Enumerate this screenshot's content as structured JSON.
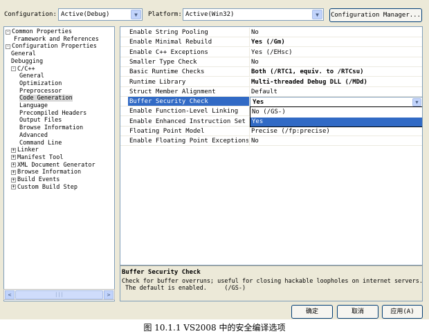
{
  "toolbar": {
    "configuration_label": "Configuration:",
    "configuration_value": "Active(Debug)",
    "platform_label": "Platform:",
    "platform_value": "Active(Win32)",
    "config_manager_label": "Configuration Manager..."
  },
  "tree": {
    "nodes": [
      {
        "label": "Common Properties",
        "expander": "-"
      },
      {
        "label": "Framework and References"
      },
      {
        "label": "Configuration Properties",
        "expander": "-"
      },
      {
        "label": "General"
      },
      {
        "label": "Debugging"
      },
      {
        "label": "C/C++",
        "expander": "-"
      },
      {
        "label": "General"
      },
      {
        "label": "Optimization"
      },
      {
        "label": "Preprocessor"
      },
      {
        "label": "Code Generation",
        "selected": true
      },
      {
        "label": "Language"
      },
      {
        "label": "Precompiled Headers"
      },
      {
        "label": "Output Files"
      },
      {
        "label": "Browse Information"
      },
      {
        "label": "Advanced"
      },
      {
        "label": "Command Line"
      },
      {
        "label": "Linker",
        "expander": "+"
      },
      {
        "label": "Manifest Tool",
        "expander": "+"
      },
      {
        "label": "XML Document Generator",
        "expander": "+"
      },
      {
        "label": "Browse Information",
        "expander": "+"
      },
      {
        "label": "Build Events",
        "expander": "+"
      },
      {
        "label": "Custom Build Step",
        "expander": "+"
      }
    ],
    "scroll_left": "<",
    "scroll_right": ">",
    "scroll_grip": "|||"
  },
  "grid": {
    "rows": [
      {
        "name": "Enable String Pooling",
        "value": "No",
        "bold": false
      },
      {
        "name": "Enable Minimal Rebuild",
        "value": "Yes (/Gm)",
        "bold": true
      },
      {
        "name": "Enable C++ Exceptions",
        "value": "Yes (/EHsc)",
        "bold": false
      },
      {
        "name": "Smaller Type Check",
        "value": "No",
        "bold": false
      },
      {
        "name": "Basic Runtime Checks",
        "value": "Both (/RTC1, equiv. to /RTCsu)",
        "bold": true
      },
      {
        "name": "Runtime Library",
        "value": "Multi-threaded Debug DLL (/MDd)",
        "bold": true
      },
      {
        "name": "Struct Member Alignment",
        "value": "Default",
        "bold": false
      },
      {
        "name": "Buffer Security Check",
        "value": "",
        "bold": false,
        "selected": true
      },
      {
        "name": "Enable Function-Level Linking",
        "value": "",
        "bold": false
      },
      {
        "name": "Enable Enhanced Instruction Set",
        "value": "",
        "bold": false
      },
      {
        "name": "Floating Point Model",
        "value": "Precise (/fp:precise)",
        "bold": false
      },
      {
        "name": "Enable Floating Point Exceptions",
        "value": "No",
        "bold": false
      }
    ],
    "dropdown": {
      "value": "Yes",
      "options": [
        {
          "label": "No (/GS-)",
          "highlighted": false
        },
        {
          "label": "Yes",
          "highlighted": true
        }
      ]
    }
  },
  "description": {
    "title": "Buffer Security Check",
    "text": "Check for buffer overruns; useful for closing hackable loopholes on internet servers.\n The default is enabled.     (/GS-)"
  },
  "buttons": {
    "ok": "确定",
    "cancel": "取消",
    "apply": "应用(A)"
  },
  "caption": "图 10.1.1  VS2008  中的安全编译选项"
}
